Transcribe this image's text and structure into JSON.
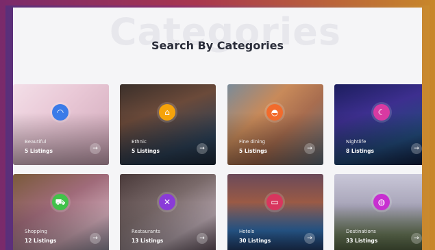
{
  "watermark": "Categories",
  "heading": "Search By Categories",
  "colors": {
    "pink": "#e92f8d",
    "blue": "#3b7be8",
    "amber": "#f5a30b",
    "orange": "#f26b2c",
    "magenta": "#d83aa2",
    "green": "#41c24a",
    "purple": "#8a3bd8",
    "crimson": "#d8365e",
    "violet": "#c72fd0"
  },
  "categories": [
    {
      "name": "Beautiful",
      "count": "5 Listings",
      "icon": "spa-icon",
      "glyph": "◠",
      "color": "#3b7be8",
      "bg": "linear-gradient(135deg,#f3dfe8 0%,#e9c8d6 40%,#cfa7b8 100%)"
    },
    {
      "name": "Ethnic",
      "count": "5 Listings",
      "icon": "dish-icon",
      "glyph": "⌂",
      "color": "#f5a30b",
      "bg": "linear-gradient(160deg,#3a2f2a 0%,#6b4a3a 35%,#2b3f55 75%,#1e2a3a 100%)"
    },
    {
      "name": "Fine dining",
      "count": "5 Listings",
      "icon": "cloche-icon",
      "glyph": "◓",
      "color": "#f26b2c",
      "bg": "linear-gradient(135deg,#7a8b99 0%,#c88a5a 35%,#a86d4f 60%,#5e6d7a 100%)"
    },
    {
      "name": "Nightlife",
      "count": "8 Listings",
      "icon": "moon-icon",
      "glyph": "☾",
      "color": "#d83aa2",
      "bg": "linear-gradient(160deg,#1c1e5e 0%,#3d2f8f 35%,#224a7a 70%,#101a3a 100%)"
    },
    {
      "name": "Shopping",
      "count": "12 Listings",
      "icon": "cart-icon",
      "glyph": "⛟",
      "color": "#41c24a",
      "bg": "linear-gradient(150deg,#7a5a3a 0%,#a06b7a 40%,#c9a3b0 70%,#8a8a9a 100%)"
    },
    {
      "name": "Restaurants",
      "count": "13 Listings",
      "icon": "cutlery-icon",
      "glyph": "✕",
      "color": "#8a3bd8",
      "bg": "linear-gradient(150deg,#4a3a3a 0%,#7a6a6a 40%,#b0a0a8 70%,#5a4a55 100%)"
    },
    {
      "name": "Hotels",
      "count": "30 Listings",
      "icon": "bed-icon",
      "glyph": "▭",
      "color": "#d8365e",
      "bg": "linear-gradient(180deg,#6b4a5a 0%,#9a5a45 35%,#2f6aa8 70%,#1d2f55 100%)"
    },
    {
      "name": "Destinations",
      "count": "33 Listings",
      "icon": "globe-icon",
      "glyph": "◍",
      "color": "#c72fd0",
      "bg": "linear-gradient(180deg,#c9c7d8 0%,#a7a4b8 40%,#6b7a5a 75%,#4a5a3a 100%)"
    }
  ]
}
